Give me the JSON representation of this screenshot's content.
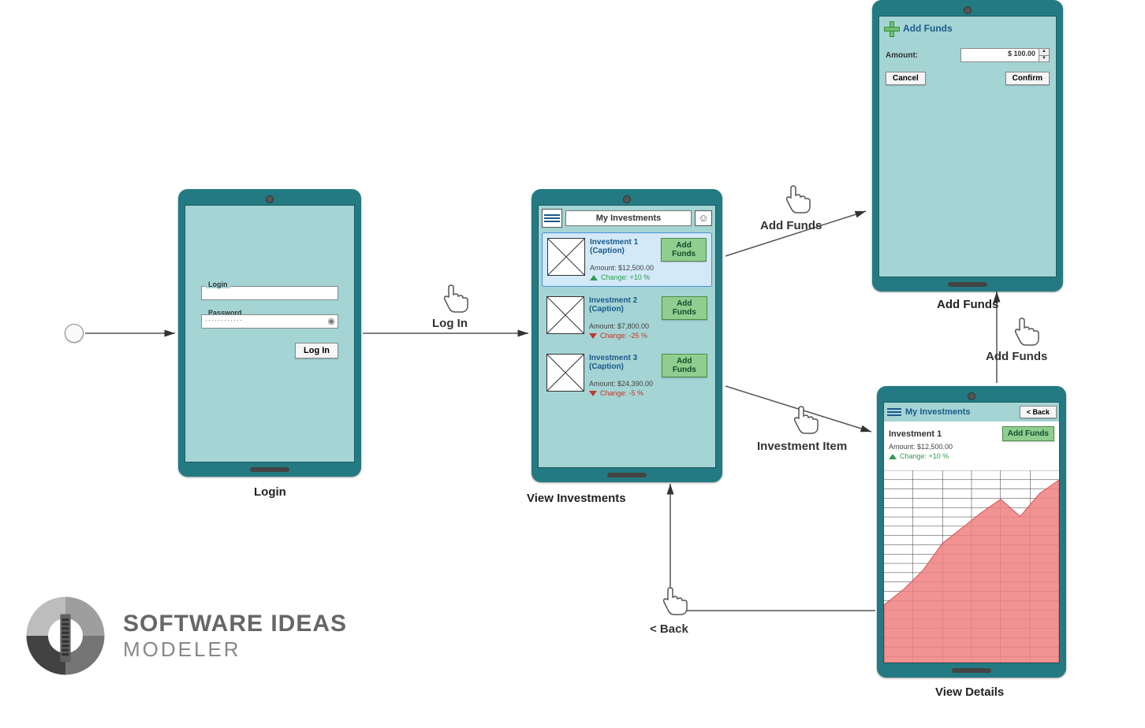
{
  "start": {},
  "loginScreen": {
    "title": "Login",
    "loginLabel": "Login",
    "passwordLabel": "Password",
    "passwordMask": "············",
    "loginBtn": "Log In"
  },
  "investmentsScreen": {
    "title": "My Investments",
    "items": [
      {
        "caption": "Investment 1 (Caption)",
        "amount": "Amount: $12,500.00",
        "change": "Change: +10 %",
        "dir": "up",
        "addBtn": "Add Funds"
      },
      {
        "caption": "Investment 2 (Caption)",
        "amount": "Amount: $7,800.00",
        "change": "Change: -25 %",
        "dir": "down",
        "addBtn": "Add Funds"
      },
      {
        "caption": "Investment 3 (Caption)",
        "amount": "Amount: $24,390.00",
        "change": "Change: -5 %",
        "dir": "down",
        "addBtn": "Add Funds"
      }
    ],
    "nodeLabel": "View Investments"
  },
  "addFundsScreen": {
    "title": "Add Funds",
    "amountLabel": "Amount:",
    "amountValue": "$ 100.00",
    "cancelBtn": "Cancel",
    "confirmBtn": "Confirm",
    "nodeLabel": "Add Funds"
  },
  "detailsScreen": {
    "headerTitle": "My Investments",
    "backBtn": "< Back",
    "itemTitle": "Investment 1",
    "addBtn": "Add Funds",
    "amount": "Amount: $12,500.00",
    "change": "Change: +10 %",
    "nodeLabel": "View Details"
  },
  "connectors": {
    "login": "Log In",
    "addFunds1": "Add Funds",
    "investmentItem": "Investment Item",
    "back": "< Back",
    "addFunds2": "Add Funds"
  },
  "brand": {
    "line1": "SOFTWARE IDEAS",
    "line2": "MODELER"
  },
  "chart_data": {
    "type": "area",
    "title": "Investment 1 value over time (wireframe)",
    "x": [
      0,
      1,
      2,
      3,
      4,
      5,
      6,
      7,
      8,
      9
    ],
    "values": [
      30,
      38,
      48,
      62,
      70,
      78,
      85,
      76,
      88,
      95
    ],
    "ylim": [
      0,
      100
    ],
    "color": "#f08080"
  }
}
